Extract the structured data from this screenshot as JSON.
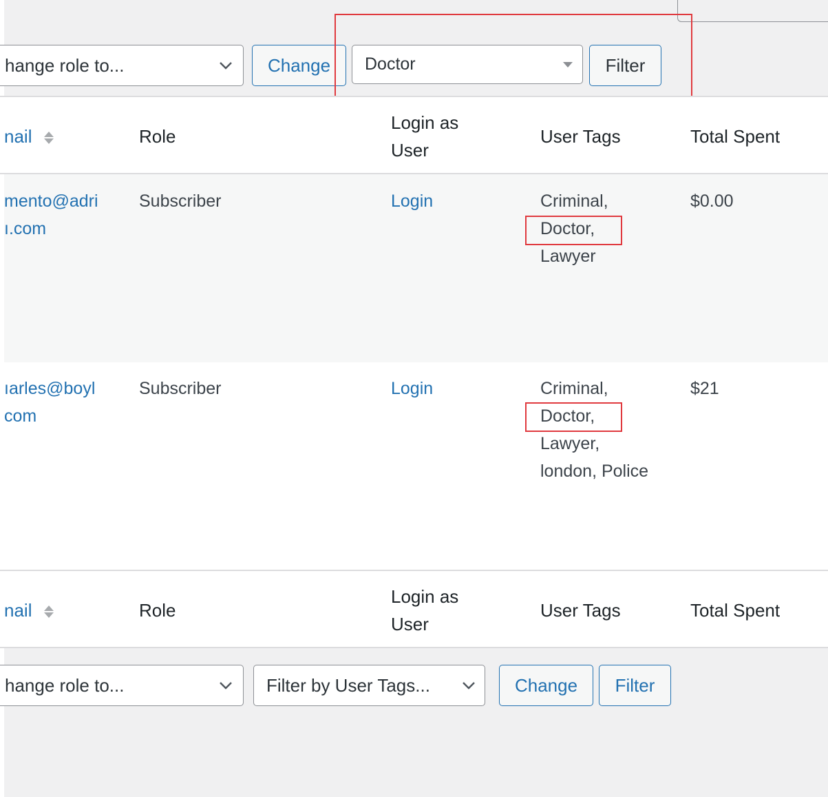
{
  "top_toolbar": {
    "bulk_role_select": {
      "value": "hange role to..."
    },
    "change_button": "Change",
    "tag_filter_select": {
      "value": "Doctor"
    },
    "filter_button": "Filter"
  },
  "table": {
    "columns": {
      "email": "nail",
      "role": "Role",
      "login_as_user": [
        "Login as",
        "User"
      ],
      "user_tags": "User Tags",
      "total_spent": "Total Spent"
    },
    "rows": [
      {
        "email": [
          "mento@adri",
          "ı.com"
        ],
        "role": "Subscriber",
        "login": "Login",
        "tags": [
          "Criminal,",
          "Doctor,",
          "Lawyer"
        ],
        "total_spent": "$0.00"
      },
      {
        "email": [
          "ıarles@boyl",
          "com"
        ],
        "role": "Subscriber",
        "login": "Login",
        "tags": [
          "Criminal,",
          "Doctor,",
          "Lawyer,",
          "london, Police"
        ],
        "total_spent": "$21"
      }
    ]
  },
  "bottom_toolbar": {
    "bulk_role_select": {
      "value": "hange role to..."
    },
    "tag_filter_select": {
      "value": "Filter by User Tags..."
    },
    "change_button": "Change",
    "filter_button": "Filter"
  },
  "colors": {
    "link": "#2271b1",
    "highlight_box": "#e0393e",
    "background": "#f0f0f1"
  }
}
